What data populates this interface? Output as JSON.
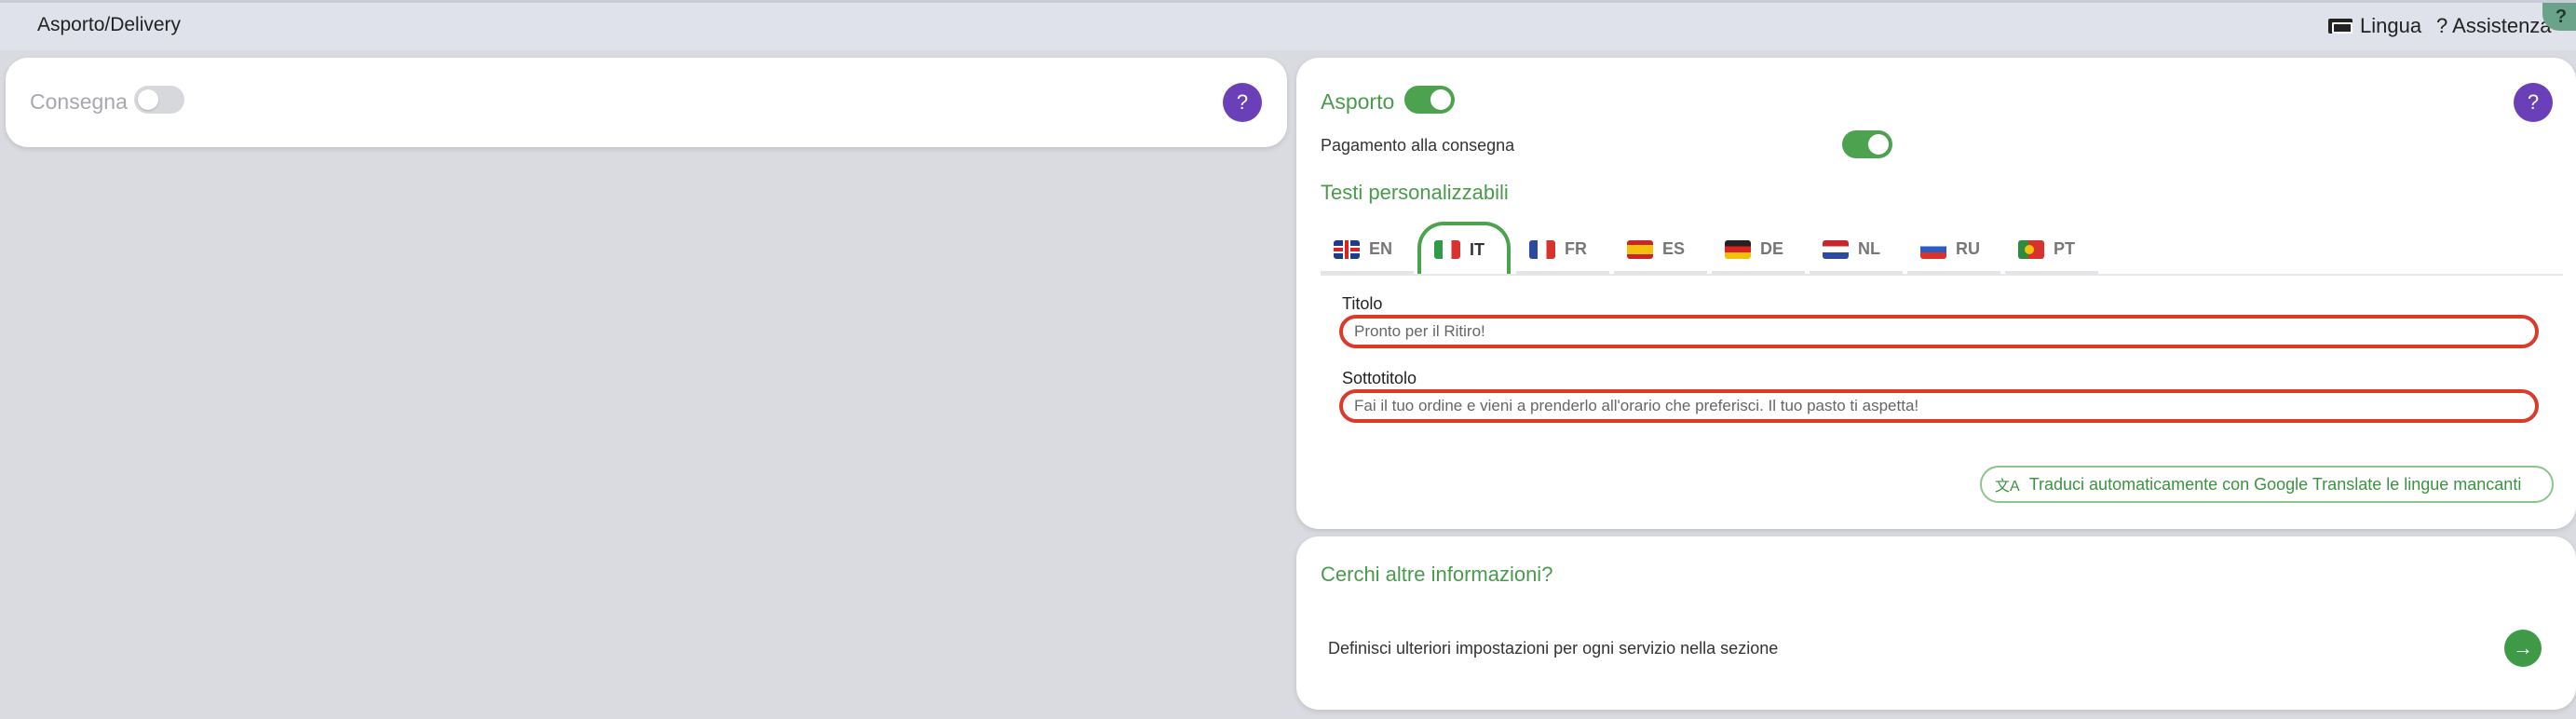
{
  "header": {
    "title": "Asporto/Delivery",
    "language_label": "Lingua",
    "assistance_icon": "?",
    "assistance_label": "Assistenza",
    "help_badge": "?"
  },
  "consegna": {
    "label": "Consegna",
    "enabled": false,
    "help": "?"
  },
  "asporto": {
    "label": "Asporto",
    "enabled": true,
    "help": "?",
    "payment_label": "Pagamento alla consegna",
    "payment_enabled": true,
    "section_title": "Testi personalizzabili",
    "tabs": [
      {
        "code": "EN",
        "flag": "flag-en",
        "active": false
      },
      {
        "code": "IT",
        "flag": "flag-it",
        "active": true
      },
      {
        "code": "FR",
        "flag": "flag-fr",
        "active": false
      },
      {
        "code": "ES",
        "flag": "flag-es",
        "active": false
      },
      {
        "code": "DE",
        "flag": "flag-de",
        "active": false
      },
      {
        "code": "NL",
        "flag": "flag-nl",
        "active": false
      },
      {
        "code": "RU",
        "flag": "flag-ru",
        "active": false
      },
      {
        "code": "PT",
        "flag": "flag-pt",
        "active": false
      }
    ],
    "title_label": "Titolo",
    "title_value": "Pronto per il Ritiro!",
    "subtitle_label": "Sottotitolo",
    "subtitle_value": "Fai il tuo ordine e vieni a prenderlo all'orario che preferisci. Il tuo pasto ti aspetta!",
    "translate_label": "Traduci automaticamente con Google Translate le lingue mancanti"
  },
  "info": {
    "title": "Cerchi altre informazioni?",
    "text": "Definisci ulteriori impostazioni per ogni servizio nella sezione",
    "arrow": "→"
  },
  "colors": {
    "accent_green": "#4ca24f",
    "help_purple": "#6b3fb8",
    "error_red": "#d93b2b"
  }
}
